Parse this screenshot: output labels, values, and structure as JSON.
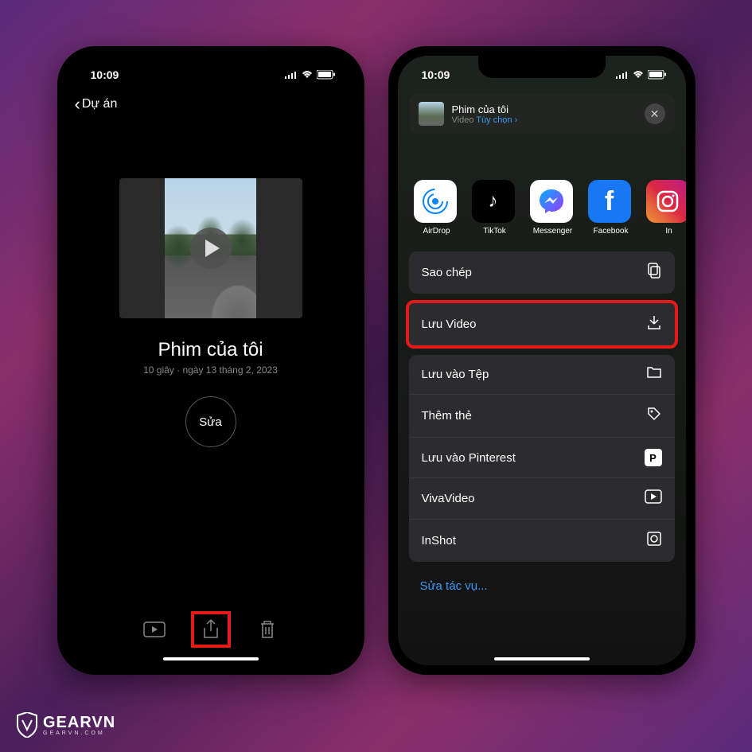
{
  "status": {
    "time": "10:09"
  },
  "phone1": {
    "back_label": "Dự án",
    "movie_title": "Phim của tôi",
    "movie_meta": "10 giây · ngày 13 tháng 2, 2023",
    "edit_label": "Sửa"
  },
  "phone2": {
    "header": {
      "title": "Phim của tôi",
      "type": "Video",
      "options": "Tùy chọn"
    },
    "apps": [
      {
        "label": "AirDrop"
      },
      {
        "label": "TikTok"
      },
      {
        "label": "Messenger"
      },
      {
        "label": "Facebook"
      },
      {
        "label": "In"
      }
    ],
    "copy_label": "Sao chép",
    "save_video_label": "Lưu Video",
    "actions": [
      {
        "label": "Lưu vào Tệp"
      },
      {
        "label": "Thêm thẻ"
      },
      {
        "label": "Lưu vào Pinterest"
      },
      {
        "label": "VivaVideo"
      },
      {
        "label": "InShot"
      }
    ],
    "edit_tasks": "Sửa tác vụ..."
  },
  "brand": {
    "name": "GEARVN",
    "site": "GEARVN.COM"
  }
}
